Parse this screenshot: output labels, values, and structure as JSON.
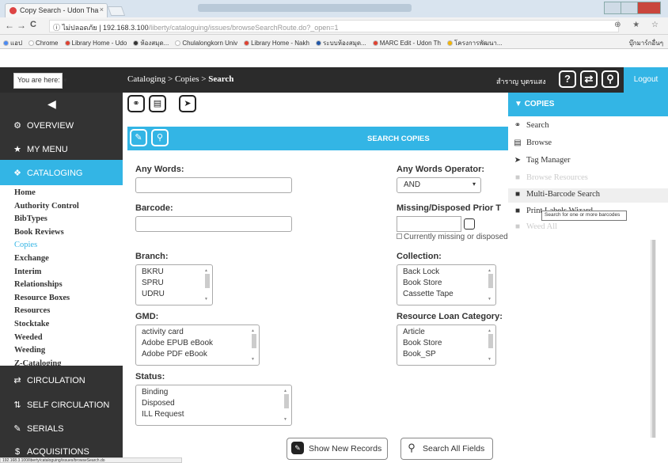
{
  "browser": {
    "tab_title": "Copy Search - Udon Tha",
    "tab_close": "×",
    "url_prefix": "ไม่ปลอดภัย",
    "url_host": "192.168.3.100",
    "url_path": "/liberty/cataloguing/issues/browseSearchRoute.do?_open=1",
    "nav_back": "←",
    "nav_forward": "→",
    "nav_reload": "C",
    "nav_info": "ⓘ",
    "right_icons": "⊕ ★ ☆",
    "bookmarks": [
      {
        "label": "แอป",
        "color": "#4a8af4"
      },
      {
        "label": "Chrome",
        "color": "#ffffff"
      },
      {
        "label": "Library Home - Udo",
        "color": "#e04030"
      },
      {
        "label": "ห้องสมุด...",
        "color": "#333333"
      },
      {
        "label": "Chulalongkorn Univ",
        "color": "#ffffff"
      },
      {
        "label": "Library Home - Nakh",
        "color": "#e04030"
      },
      {
        "label": "ระบบห้องสมุด...",
        "color": "#1f56a8"
      },
      {
        "label": "MARC Edit - Udon Th",
        "color": "#e04030"
      },
      {
        "label": "โครงการพัฒนา...",
        "color": "#f4b400"
      }
    ],
    "bookmark_more": "บุ๊กมาร์กอื่นๆ",
    "status_url": "192.168.3.100/liberty/cataloguing/issues/browseSearch.do"
  },
  "header": {
    "you_are_here": "You are here:",
    "you_are_here_arrow": "▼",
    "breadcrumb_prefix": "Cataloging > Copies > ",
    "breadcrumb_current": "Search",
    "username": "สำราญ บุตรแสง",
    "help_icon": "?",
    "switch_icon": "⇄",
    "search_icon": "⚲",
    "logout": "Logout"
  },
  "sidebar": {
    "collapse_icon": "◀",
    "sections": [
      {
        "label": "OVERVIEW",
        "icon": "⚙"
      },
      {
        "label": "MY MENU",
        "icon": "★"
      },
      {
        "label": "CATALOGING",
        "icon": "❖"
      },
      {
        "label": "CIRCULATION",
        "icon": "⇄"
      },
      {
        "label": "SELF CIRCULATION",
        "icon": "⇅"
      },
      {
        "label": "SERIALS",
        "icon": "✎"
      },
      {
        "label": "ACQUISITIONS",
        "icon": "$"
      }
    ],
    "cataloging_items": [
      "Home",
      "Authority Control",
      "BibTypes",
      "Book Reviews",
      "Copies",
      "Exchange",
      "Interim",
      "Relationships",
      "Resource Boxes",
      "Resources",
      "Stocktake",
      "Weeded",
      "Weeding",
      "Z-Cataloging"
    ]
  },
  "toolbar": {
    "binoculars_icon": "⚭",
    "browse_icon": "▤",
    "tag_icon": "➤"
  },
  "search_bar": {
    "title": "SEARCH COPIES",
    "clear_icon": "✎",
    "search_icon": "⚲"
  },
  "form": {
    "any_words_label": "Any Words:",
    "any_words_value": "",
    "any_words_operator_label": "Any Words Operator:",
    "operator_value": "AND",
    "select_arrow": "▾",
    "barcode_label": "Barcode:",
    "barcode_value": "",
    "missing_label": "Missing/Disposed Prior T",
    "missing_checkbox_label": "Currently missing or disposed",
    "branch_label": "Branch:",
    "branch_options": [
      "BKRU",
      "SPRU",
      "UDRU"
    ],
    "collection_label": "Collection:",
    "collection_options": [
      "Back Lock",
      "Book Store",
      "Cassette Tape"
    ],
    "gmd_label": "GMD:",
    "gmd_options": [
      "activity card",
      "Adobe EPUB eBook",
      "Adobe PDF eBook"
    ],
    "loan_category_label": "Resource Loan Category:",
    "loan_category_options": [
      "Article",
      "Book Store",
      "Book_SP"
    ],
    "status_label": "Status:",
    "status_options": [
      "Binding",
      "Disposed",
      "ILL Request"
    ],
    "show_new_records": "Show New Records",
    "show_new_records_icon": "✎",
    "search_all_fields": "Search All Fields",
    "search_all_fields_icon": "⚲",
    "scroll_up": "▲",
    "scroll_down": "▼"
  },
  "copies_menu": {
    "title": "COPIES",
    "title_arrow": "▼",
    "items": [
      {
        "label": "Search",
        "icon": "⚭",
        "enabled": true
      },
      {
        "label": "Browse",
        "icon": "▤",
        "enabled": true
      },
      {
        "label": "Tag Manager",
        "icon": "➤",
        "enabled": true
      },
      {
        "label": "Browse Resources",
        "icon": "■",
        "enabled": false
      },
      {
        "label": "Multi-Barcode Search",
        "icon": "■",
        "enabled": true
      },
      {
        "label": "Print Labels Wizard",
        "icon": "■",
        "enabled": true
      },
      {
        "label": "Weed All",
        "icon": "■",
        "enabled": false
      }
    ],
    "tooltip": "Search for one or more barcodes"
  }
}
